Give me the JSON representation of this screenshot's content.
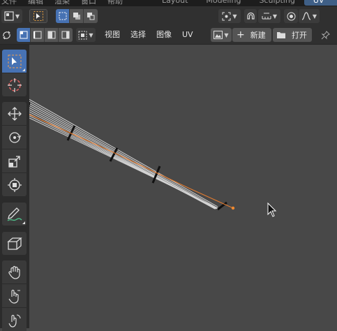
{
  "top_menu": [
    "文件",
    "编辑",
    "渲染",
    "窗口",
    "帮助"
  ],
  "workspace_tabs": [
    {
      "label": "Layout",
      "active": false
    },
    {
      "label": "Modeling",
      "active": false
    },
    {
      "label": "Sculpting",
      "active": false
    },
    {
      "label": "UV Editing",
      "active": true
    }
  ],
  "header2": {
    "menus": [
      "视图",
      "选择",
      "图像",
      "UV"
    ],
    "new_label": "新建",
    "open_label": "打开",
    "new_icon": "plus-icon",
    "open_icon": "folder-icon",
    "pin_icon": "pin-icon"
  },
  "toolbar": [
    {
      "name": "select-box-tool",
      "icon": "select-box-icon",
      "active": true
    },
    {
      "name": "cursor-tool",
      "icon": "cursor-icon",
      "active": false
    },
    {
      "name": "move-tool",
      "icon": "move-icon",
      "active": false
    },
    {
      "name": "rotate-tool",
      "icon": "rotate-icon",
      "active": false
    },
    {
      "name": "scale-tool",
      "icon": "scale-icon",
      "active": false
    },
    {
      "name": "transform-tool",
      "icon": "transform-icon",
      "active": false
    },
    {
      "name": "annotate-tool",
      "icon": "annotate-icon",
      "active": false
    },
    {
      "name": "rip-region-tool",
      "icon": "rip-region-icon",
      "active": false
    },
    {
      "name": "grab-tool",
      "icon": "grab-icon",
      "active": false
    },
    {
      "name": "relax-tool",
      "icon": "relax-icon",
      "active": false
    },
    {
      "name": "pinch-tool",
      "icon": "pinch-icon",
      "active": false
    }
  ],
  "colors": {
    "accent": "#4772b3",
    "viewport_bg": "#484848",
    "header_bg": "#303030",
    "uv_wire": "#d8d8d8",
    "uv_selected": "#e07a30"
  }
}
